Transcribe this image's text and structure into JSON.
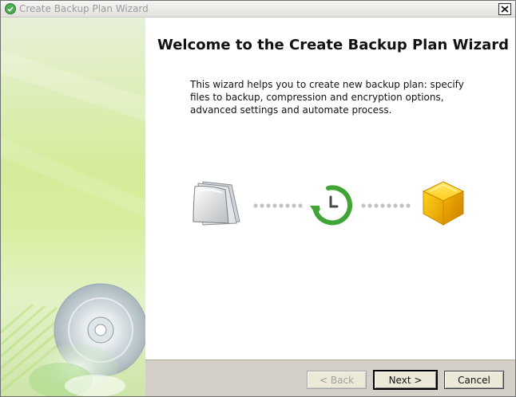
{
  "window": {
    "title": "Create Backup Plan Wizard",
    "icons": {
      "app": "backup-app-icon",
      "close": "close-icon"
    }
  },
  "content": {
    "heading": "Welcome to the Create Backup Plan Wizard",
    "description": "This wizard helps you to create new backup plan: specify files to backup, compression and encryption options, advanced settings and automate process.",
    "flow_icons": [
      "documents-icon",
      "schedule-clock-icon",
      "storage-cube-icon"
    ]
  },
  "footer": {
    "back_label": "< Back",
    "next_label": "Next >",
    "cancel_label": "Cancel"
  },
  "colors": {
    "accent_green": "#3fa535",
    "cube_yellow": "#f2b600",
    "side_green": "#d4ec9a"
  }
}
